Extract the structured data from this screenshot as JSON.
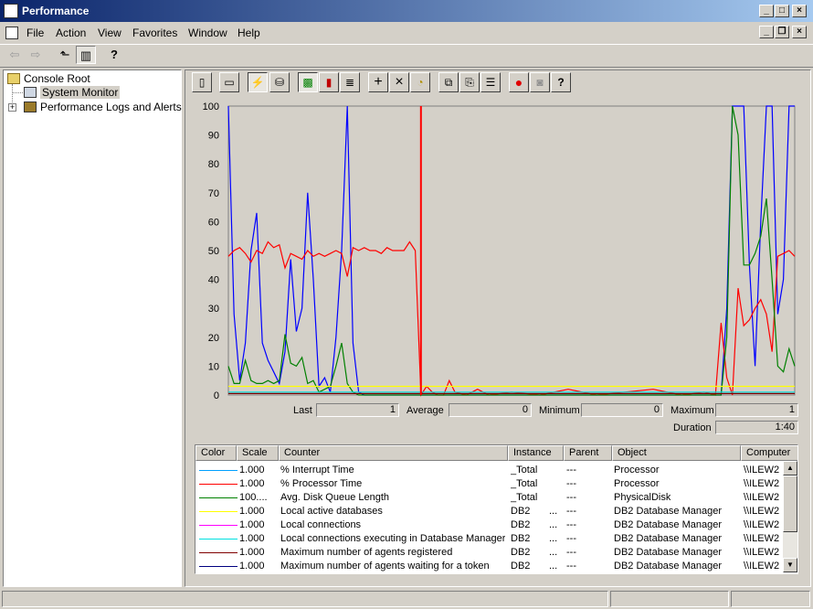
{
  "window": {
    "title": "Performance",
    "controls": {
      "minimize": "_",
      "maximize": "□",
      "close": "×"
    },
    "mdi_controls": {
      "minimize": "_",
      "restore": "❐",
      "close": "×"
    }
  },
  "menu": {
    "items": [
      {
        "label": "File"
      },
      {
        "label": "Action"
      },
      {
        "label": "View"
      },
      {
        "label": "Favorites"
      },
      {
        "label": "Window"
      },
      {
        "label": "Help"
      }
    ]
  },
  "toolbar": {
    "back_icon": "arrow-left-icon",
    "forward_icon": "arrow-right-icon",
    "up_icon": "up-folder-icon",
    "tree_icon": "show-hide-tree-icon",
    "help_icon": "help-icon",
    "glyphs": {
      "back": "⇦",
      "forward": "⇨",
      "up": "⬑",
      "tree": "▥",
      "help": "?"
    }
  },
  "tree": {
    "root": "Console Root",
    "items": [
      {
        "label": "System Monitor",
        "selected": true
      },
      {
        "label": "Performance Logs and Alerts",
        "expander": "+"
      }
    ]
  },
  "monitor_toolbar": {
    "buttons": [
      {
        "name": "new-counter-set",
        "glyph": "▯"
      },
      {
        "name": "clear-display",
        "glyph": "▭"
      },
      {
        "name": "view-current-activity",
        "glyph": "⚡"
      },
      {
        "name": "view-log-data",
        "glyph": "⛁"
      },
      {
        "name": "view-graph",
        "glyph": "▩"
      },
      {
        "name": "view-histogram",
        "glyph": "▮"
      },
      {
        "name": "view-report",
        "glyph": "≣"
      },
      {
        "name": "add-counter",
        "glyph": "+"
      },
      {
        "name": "delete-counter",
        "glyph": "×"
      },
      {
        "name": "highlight",
        "glyph": "◔"
      },
      {
        "name": "copy-properties",
        "glyph": "⧉"
      },
      {
        "name": "paste-counter-list",
        "glyph": "⎘"
      },
      {
        "name": "properties",
        "glyph": "☰"
      },
      {
        "name": "freeze-display",
        "glyph": "●"
      },
      {
        "name": "update-data",
        "glyph": "◙"
      },
      {
        "name": "help",
        "glyph": "?"
      }
    ]
  },
  "chart_data": {
    "type": "line",
    "ylim": [
      0,
      100
    ],
    "yticks": [
      "100",
      "90",
      "80",
      "70",
      "60",
      "50",
      "40",
      "30",
      "20",
      "10",
      "0"
    ],
    "grid": false,
    "time_bar_at": 0.34,
    "x_count": 101,
    "series": [
      {
        "color": "#0000ff",
        "values": [
          {
            "x": 0,
            "y": 100
          },
          {
            "x": 1,
            "y": 28
          },
          {
            "x": 2,
            "y": 5
          },
          {
            "x": 3,
            "y": 18
          },
          {
            "x": 4,
            "y": 50
          },
          {
            "x": 5,
            "y": 63
          },
          {
            "x": 6,
            "y": 18
          },
          {
            "x": 7,
            "y": 12
          },
          {
            "x": 8,
            "y": 8
          },
          {
            "x": 9,
            "y": 4
          },
          {
            "x": 10,
            "y": 15
          },
          {
            "x": 11,
            "y": 47
          },
          {
            "x": 12,
            "y": 22
          },
          {
            "x": 13,
            "y": 30
          },
          {
            "x": 14,
            "y": 70
          },
          {
            "x": 15,
            "y": 40
          },
          {
            "x": 16,
            "y": 3
          },
          {
            "x": 17,
            "y": 6
          },
          {
            "x": 18,
            "y": 1
          },
          {
            "x": 19,
            "y": 20
          },
          {
            "x": 20,
            "y": 50
          },
          {
            "x": 21,
            "y": 100
          },
          {
            "x": 22,
            "y": 18
          },
          {
            "x": 23,
            "y": 1
          },
          {
            "x": 24,
            "y": 0
          },
          {
            "x": 25,
            "y": 0
          },
          {
            "x": 30,
            "y": 0
          },
          {
            "x": 40,
            "y": 0
          },
          {
            "x": 50,
            "y": 0
          },
          {
            "x": 60,
            "y": 0
          },
          {
            "x": 70,
            "y": 0
          },
          {
            "x": 80,
            "y": 0
          },
          {
            "x": 86,
            "y": 0
          },
          {
            "x": 87,
            "y": 0
          },
          {
            "x": 88,
            "y": 30
          },
          {
            "x": 89,
            "y": 100
          },
          {
            "x": 90,
            "y": 100
          },
          {
            "x": 91,
            "y": 100
          },
          {
            "x": 92,
            "y": 45
          },
          {
            "x": 93,
            "y": 10
          },
          {
            "x": 94,
            "y": 60
          },
          {
            "x": 95,
            "y": 100
          },
          {
            "x": 96,
            "y": 100
          },
          {
            "x": 97,
            "y": 28
          },
          {
            "x": 98,
            "y": 40
          },
          {
            "x": 99,
            "y": 100
          },
          {
            "x": 100,
            "y": 100
          }
        ]
      },
      {
        "color": "#ff0000",
        "values": [
          {
            "x": 0,
            "y": 48
          },
          {
            "x": 1,
            "y": 50
          },
          {
            "x": 2,
            "y": 51
          },
          {
            "x": 3,
            "y": 49
          },
          {
            "x": 4,
            "y": 46
          },
          {
            "x": 5,
            "y": 50
          },
          {
            "x": 6,
            "y": 49
          },
          {
            "x": 7,
            "y": 53
          },
          {
            "x": 8,
            "y": 51
          },
          {
            "x": 9,
            "y": 52
          },
          {
            "x": 10,
            "y": 44
          },
          {
            "x": 11,
            "y": 49
          },
          {
            "x": 12,
            "y": 48
          },
          {
            "x": 13,
            "y": 47
          },
          {
            "x": 14,
            "y": 50
          },
          {
            "x": 15,
            "y": 48
          },
          {
            "x": 16,
            "y": 49
          },
          {
            "x": 17,
            "y": 48
          },
          {
            "x": 18,
            "y": 49
          },
          {
            "x": 19,
            "y": 50
          },
          {
            "x": 20,
            "y": 49
          },
          {
            "x": 21,
            "y": 41
          },
          {
            "x": 22,
            "y": 51
          },
          {
            "x": 23,
            "y": 50
          },
          {
            "x": 24,
            "y": 51
          },
          {
            "x": 25,
            "y": 50
          },
          {
            "x": 26,
            "y": 50
          },
          {
            "x": 27,
            "y": 49
          },
          {
            "x": 28,
            "y": 51
          },
          {
            "x": 29,
            "y": 50
          },
          {
            "x": 30,
            "y": 50
          },
          {
            "x": 31,
            "y": 50
          },
          {
            "x": 32,
            "y": 53
          },
          {
            "x": 33,
            "y": 50
          },
          {
            "x": 34,
            "y": 0
          },
          {
            "x": 35,
            "y": 3
          },
          {
            "x": 36,
            "y": 1
          },
          {
            "x": 37,
            "y": 0
          },
          {
            "x": 38,
            "y": 0
          },
          {
            "x": 39,
            "y": 5
          },
          {
            "x": 40,
            "y": 1
          },
          {
            "x": 42,
            "y": 0
          },
          {
            "x": 44,
            "y": 2
          },
          {
            "x": 46,
            "y": 0
          },
          {
            "x": 50,
            "y": 1
          },
          {
            "x": 55,
            "y": 0
          },
          {
            "x": 60,
            "y": 2
          },
          {
            "x": 65,
            "y": 0
          },
          {
            "x": 70,
            "y": 1
          },
          {
            "x": 75,
            "y": 2
          },
          {
            "x": 80,
            "y": 0
          },
          {
            "x": 84,
            "y": 1
          },
          {
            "x": 86,
            "y": 0
          },
          {
            "x": 87,
            "y": 25
          },
          {
            "x": 88,
            "y": 6
          },
          {
            "x": 89,
            "y": 0
          },
          {
            "x": 90,
            "y": 37
          },
          {
            "x": 91,
            "y": 24
          },
          {
            "x": 92,
            "y": 26
          },
          {
            "x": 93,
            "y": 30
          },
          {
            "x": 94,
            "y": 33
          },
          {
            "x": 95,
            "y": 28
          },
          {
            "x": 96,
            "y": 15
          },
          {
            "x": 97,
            "y": 48
          },
          {
            "x": 98,
            "y": 49
          },
          {
            "x": 99,
            "y": 50
          },
          {
            "x": 100,
            "y": 48
          }
        ]
      },
      {
        "color": "#008000",
        "values": [
          {
            "x": 0,
            "y": 10
          },
          {
            "x": 1,
            "y": 4
          },
          {
            "x": 2,
            "y": 4
          },
          {
            "x": 3,
            "y": 12
          },
          {
            "x": 4,
            "y": 5
          },
          {
            "x": 5,
            "y": 4
          },
          {
            "x": 6,
            "y": 4
          },
          {
            "x": 7,
            "y": 5
          },
          {
            "x": 8,
            "y": 4
          },
          {
            "x": 9,
            "y": 5
          },
          {
            "x": 10,
            "y": 21
          },
          {
            "x": 11,
            "y": 11
          },
          {
            "x": 12,
            "y": 10
          },
          {
            "x": 13,
            "y": 13
          },
          {
            "x": 14,
            "y": 4
          },
          {
            "x": 15,
            "y": 5
          },
          {
            "x": 16,
            "y": 1
          },
          {
            "x": 17,
            "y": 2
          },
          {
            "x": 18,
            "y": 3
          },
          {
            "x": 19,
            "y": 10
          },
          {
            "x": 20,
            "y": 18
          },
          {
            "x": 21,
            "y": 4
          },
          {
            "x": 22,
            "y": 1
          },
          {
            "x": 23,
            "y": 0
          },
          {
            "x": 30,
            "y": 0
          },
          {
            "x": 50,
            "y": 0
          },
          {
            "x": 70,
            "y": 0
          },
          {
            "x": 86,
            "y": 0
          },
          {
            "x": 87,
            "y": 0
          },
          {
            "x": 88,
            "y": 20
          },
          {
            "x": 89,
            "y": 100
          },
          {
            "x": 90,
            "y": 90
          },
          {
            "x": 91,
            "y": 45
          },
          {
            "x": 92,
            "y": 45
          },
          {
            "x": 93,
            "y": 49
          },
          {
            "x": 94,
            "y": 55
          },
          {
            "x": 95,
            "y": 68
          },
          {
            "x": 96,
            "y": 40
          },
          {
            "x": 97,
            "y": 10
          },
          {
            "x": 98,
            "y": 8
          },
          {
            "x": 99,
            "y": 16
          },
          {
            "x": 100,
            "y": 10
          }
        ]
      },
      {
        "color": "#ffff00",
        "values": [
          {
            "x": 0,
            "y": 3
          },
          {
            "x": 100,
            "y": 3
          }
        ]
      },
      {
        "color": "#00e0e0",
        "values": [
          {
            "x": 0,
            "y": 1
          },
          {
            "x": 100,
            "y": 1
          }
        ]
      },
      {
        "color": "#800000",
        "values": [
          {
            "x": 0,
            "y": 0.5
          },
          {
            "x": 100,
            "y": 0.5
          }
        ]
      }
    ]
  },
  "stats": {
    "last_label": "Last",
    "last_value": "1",
    "average_label": "Average",
    "average_value": "0",
    "minimum_label": "Minimum",
    "minimum_value": "0",
    "maximum_label": "Maximum",
    "maximum_value": "1",
    "duration_label": "Duration",
    "duration_value": "1:40"
  },
  "counter_list": {
    "headers": [
      "Color",
      "Scale",
      "Counter",
      "Instance",
      "Parent",
      "Object",
      "Computer"
    ],
    "rows": [
      {
        "color": "#00a0ff",
        "scale": "1.000",
        "counter": "% Interrupt Time",
        "instance": "_Total",
        "parent": "---",
        "object": "Processor",
        "computer": "\\\\ILEW2"
      },
      {
        "color": "#ff0000",
        "scale": "1.000",
        "counter": "% Processor Time",
        "instance": "_Total",
        "parent": "---",
        "object": "Processor",
        "computer": "\\\\ILEW2"
      },
      {
        "color": "#008000",
        "scale": "100....",
        "counter": "Avg. Disk Queue Length",
        "instance": "_Total",
        "parent": "---",
        "object": "PhysicalDisk",
        "computer": "\\\\ILEW2"
      },
      {
        "color": "#ffff00",
        "scale": "1.000",
        "counter": "Local active databases",
        "instance": "DB2",
        "parent": "---",
        "object": "DB2 Database Manager",
        "computer": "\\\\ILEW2"
      },
      {
        "color": "#ff00ff",
        "scale": "1.000",
        "counter": "Local connections",
        "instance": "DB2",
        "parent": "---",
        "object": "DB2 Database Manager",
        "computer": "\\\\ILEW2"
      },
      {
        "color": "#00e0e0",
        "scale": "1.000",
        "counter": "Local connections executing in Database Manager",
        "instance": "DB2",
        "parent": "---",
        "object": "DB2 Database Manager",
        "computer": "\\\\ILEW2"
      },
      {
        "color": "#800000",
        "scale": "1.000",
        "counter": "Maximum number of agents registered",
        "instance": "DB2",
        "parent": "---",
        "object": "DB2 Database Manager",
        "computer": "\\\\ILEW2"
      },
      {
        "color": "#000080",
        "scale": "1.000",
        "counter": "Maximum number of agents waiting for a token",
        "instance": "DB2",
        "parent": "---",
        "object": "DB2 Database Manager",
        "computer": "\\\\ILEW2"
      }
    ],
    "instance_ellipsis": "..."
  },
  "scrollbar": {
    "up": "▲",
    "down": "▼"
  }
}
